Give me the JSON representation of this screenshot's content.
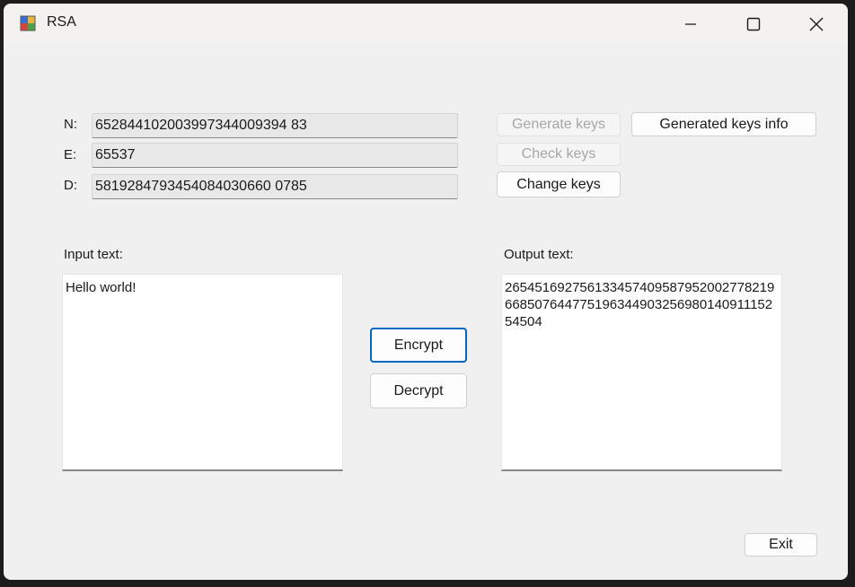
{
  "window": {
    "title": "RSA"
  },
  "keys": {
    "n_label": "N:",
    "n_value": "652844102003997344009394 83",
    "e_label": "E:",
    "e_value": "65537",
    "d_label": "D:",
    "d_value": "5819284793454084030660 0785"
  },
  "buttons": {
    "generate_keys": "Generate keys",
    "generated_keys_info": "Generated keys info",
    "check_keys": "Check keys",
    "change_keys": "Change keys",
    "encrypt": "Encrypt",
    "decrypt": "Decrypt",
    "exit": "Exit"
  },
  "input": {
    "label": "Input text:",
    "value": "Hello world!"
  },
  "output": {
    "label": "Output text:",
    "value": "26545169275613345740958795200277821966850764477519634490325698014091115254504"
  },
  "icons": {
    "app": "app-icon",
    "minimize": "minimize-icon",
    "maximize": "maximize-icon",
    "close": "close-icon"
  },
  "colors": {
    "accent": "#0067c0",
    "disabled_text": "#a6a6a6"
  }
}
